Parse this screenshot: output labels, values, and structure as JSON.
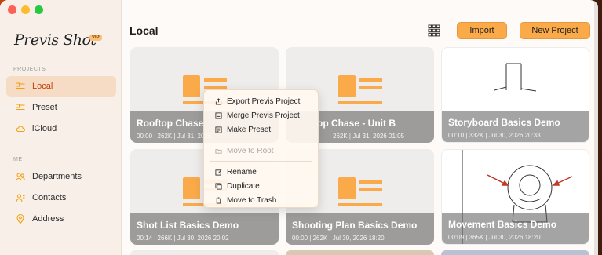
{
  "app": {
    "logo": "Previs Shot",
    "badge": "VIP"
  },
  "sidebar": {
    "projects_label": "PROJECTS",
    "me_label": "ME",
    "items": [
      {
        "label": "Local",
        "icon": "local-icon",
        "active": true
      },
      {
        "label": "Preset",
        "icon": "preset-icon",
        "active": false
      },
      {
        "label": "iCloud",
        "icon": "cloud-icon",
        "active": false
      }
    ],
    "me_items": [
      {
        "label": "Departments",
        "icon": "departments-icon"
      },
      {
        "label": "Contacts",
        "icon": "contacts-icon"
      },
      {
        "label": "Address",
        "icon": "location-icon"
      }
    ]
  },
  "main": {
    "title": "Local",
    "import_label": "Import",
    "new_project_label": "New Project"
  },
  "cards": [
    {
      "title": "Rooftop Chase",
      "meta": "00:00 | 262K | Jul 31, 2026"
    },
    {
      "title": "op Chase - Unit B",
      "meta": "262K | Jul 31, 2026 01:05"
    },
    {
      "title": "Storyboard Basics Demo",
      "meta": "00:10 | 332K | Jul 30, 2026 20:33"
    },
    {
      "title": "Shot List Basics Demo",
      "meta": "00:14 | 266K | Jul 30, 2026 20:02"
    },
    {
      "title": "Shooting Plan Basics Demo",
      "meta": "00:00 | 262K | Jul 30, 2026 18:20"
    },
    {
      "title": "Movement Basics Demo",
      "meta": "00:09 | 365K | Jul 30, 2026 18:20"
    }
  ],
  "context_menu": {
    "items": [
      {
        "label": "Export Previs Project",
        "icon": "export-icon",
        "disabled": false
      },
      {
        "label": "Merge Previs Project",
        "icon": "merge-icon",
        "disabled": false
      },
      {
        "label": "Make Preset",
        "icon": "preset-icon",
        "disabled": false
      },
      {
        "label": "Move to Root",
        "icon": "move-root-icon",
        "disabled": true
      },
      {
        "label": "Rename",
        "icon": "rename-icon",
        "disabled": false
      },
      {
        "label": "Duplicate",
        "icon": "duplicate-icon",
        "disabled": false
      },
      {
        "label": "Move to Trash",
        "icon": "trash-icon",
        "disabled": false
      }
    ]
  },
  "colors": {
    "accent": "#fbaa4a",
    "active_bg": "#f6dcc4",
    "active_text": "#c2410c"
  }
}
